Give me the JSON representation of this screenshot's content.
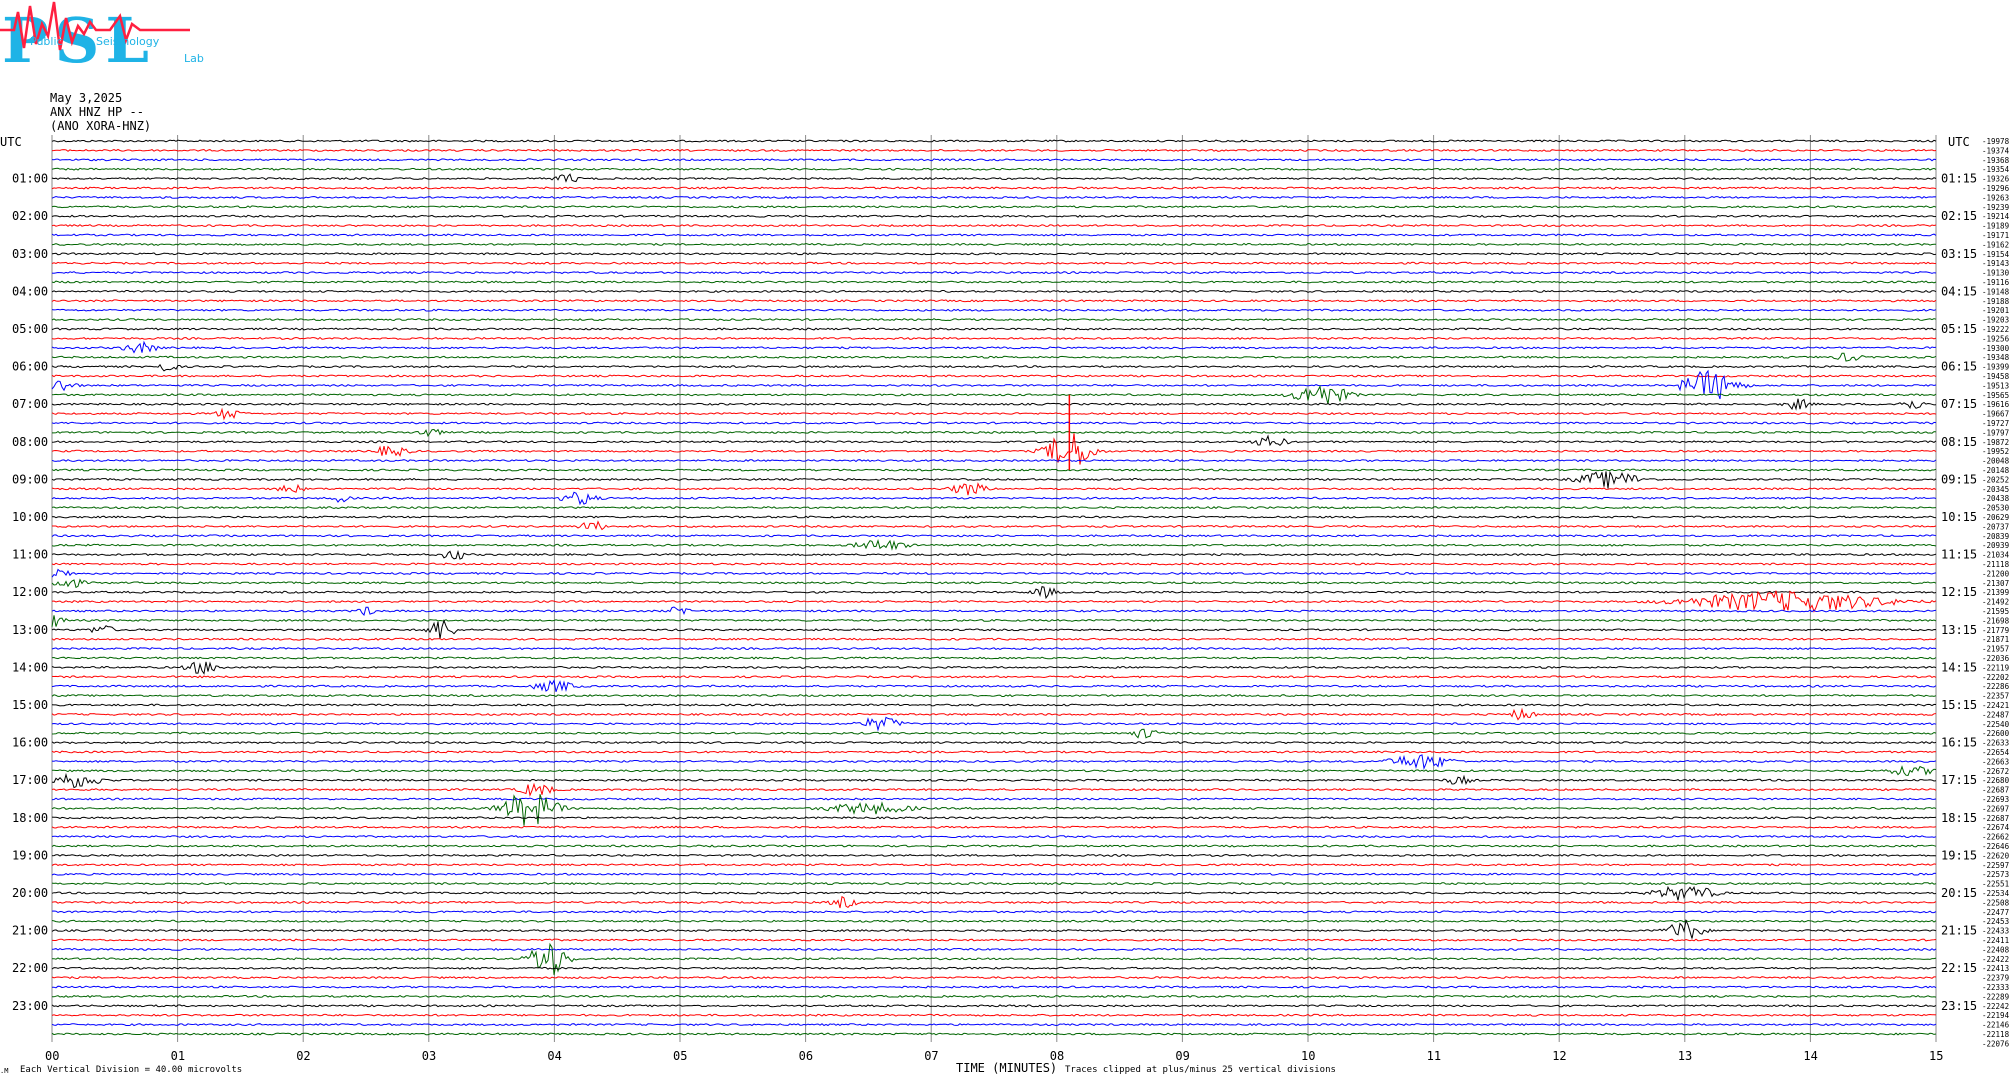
{
  "logo": {
    "letters": "PSL",
    "subtitle_a": "Public",
    "subtitle_b": "Seismology",
    "subtitle_c": "Lab"
  },
  "header": {
    "date": "May 3,2025",
    "channel": "ANX HNZ HP --",
    "source": "(ANO XORA-HNZ)"
  },
  "axis": {
    "left_label": "UTC",
    "right_label": "UTC",
    "xlabel": "TIME (MINUTES)"
  },
  "footer": {
    "scale_note": "Each Vertical Division = 40.00 microvolts",
    "clip_note": "Traces clipped at plus/minus 25 vertical divisions",
    "small_mark": ".M"
  },
  "chart_data": {
    "type": "line",
    "title": "May 3,2025",
    "xlabel": "TIME (MINUTES)",
    "xlim": [
      0,
      15
    ],
    "x_ticks": [
      "00",
      "01",
      "02",
      "03",
      "04",
      "05",
      "06",
      "07",
      "08",
      "09",
      "10",
      "11",
      "12",
      "13",
      "14",
      "15"
    ],
    "left_hour_labels": [
      "01:00",
      "02:00",
      "03:00",
      "04:00",
      "05:00",
      "06:00",
      "07:00",
      "08:00",
      "09:00",
      "10:00",
      "11:00",
      "12:00",
      "13:00",
      "14:00",
      "15:00",
      "16:00",
      "17:00",
      "18:00",
      "19:00",
      "20:00",
      "21:00",
      "22:00",
      "23:00"
    ],
    "right_hour_labels": [
      "01:15",
      "02:15",
      "03:15",
      "04:15",
      "05:15",
      "06:15",
      "07:15",
      "08:15",
      "09:15",
      "10:15",
      "11:15",
      "12:15",
      "13:15",
      "14:15",
      "15:15",
      "16:15",
      "17:15",
      "18:15",
      "19:15",
      "20:15",
      "21:15",
      "22:15",
      "23:15"
    ],
    "trace_colors": [
      "#000000",
      "#ff0000",
      "#0000ff",
      "#006400"
    ],
    "trace_count": 96,
    "minutes_per_trace": 15,
    "offsets": [
      "-19978",
      "-19374",
      "-19368",
      "-19354",
      "-19326",
      "-19296",
      "-19263",
      "-19239",
      "-19214",
      "-19189",
      "-19171",
      "-19162",
      "-19154",
      "-19143",
      "-19130",
      "-19116",
      "-19148",
      "-19188",
      "-19201",
      "-19203",
      "-19222",
      "-19256",
      "-19300",
      "-19348",
      "-19399",
      "-19458",
      "-19513",
      "-19565",
      "-19616",
      "-19667",
      "-19727",
      "-19797",
      "-19872",
      "-19952",
      "-20048",
      "-20148",
      "-20252",
      "-20345",
      "-20438",
      "-20530",
      "-20629",
      "-20737",
      "-20839",
      "-20939",
      "-21034",
      "-21118",
      "-21200",
      "-21307",
      "-21399",
      "-21492",
      "-21595",
      "-21698",
      "-21779",
      "-21871",
      "-21957",
      "-22036",
      "-22119",
      "-22202",
      "-22286",
      "-22357",
      "-22421",
      "-22487",
      "-22540",
      "-22600",
      "-22633",
      "-22654",
      "-22663",
      "-22672",
      "-22680",
      "-22687",
      "-22693",
      "-22697",
      "-22687",
      "-22674",
      "-22662",
      "-22646",
      "-22620",
      "-22597",
      "-22573",
      "-22551",
      "-22534",
      "-22508",
      "-22477",
      "-22453",
      "-22433",
      "-22411",
      "-22408",
      "-22422",
      "-22413",
      "-22379",
      "-22333",
      "-22289",
      "-22242",
      "-22194",
      "-22146",
      "-22118",
      "-22076"
    ],
    "events": [
      {
        "trace": 4,
        "minute": 4.1,
        "amp": 5,
        "dur": 0.15
      },
      {
        "trace": 22,
        "minute": 0.7,
        "amp": 6,
        "dur": 0.2
      },
      {
        "trace": 23,
        "minute": 14.3,
        "amp": 5,
        "dur": 0.15
      },
      {
        "trace": 24,
        "minute": 0.9,
        "amp": 5,
        "dur": 0.15
      },
      {
        "trace": 26,
        "minute": 0.05,
        "amp": 7,
        "dur": 0.2
      },
      {
        "trace": 26,
        "minute": 13.2,
        "amp": 16,
        "dur": 0.3
      },
      {
        "trace": 27,
        "minute": 10.1,
        "amp": 12,
        "dur": 0.3
      },
      {
        "trace": 28,
        "minute": 13.9,
        "amp": 6,
        "dur": 0.15
      },
      {
        "trace": 28,
        "minute": 14.8,
        "amp": 6,
        "dur": 0.15
      },
      {
        "trace": 29,
        "minute": 1.4,
        "amp": 6,
        "dur": 0.15
      },
      {
        "trace": 31,
        "minute": 3.0,
        "amp": 5,
        "dur": 0.15
      },
      {
        "trace": 32,
        "minute": 9.7,
        "amp": 6,
        "dur": 0.2
      },
      {
        "trace": 33,
        "minute": 8.1,
        "amp": 20,
        "dur": 0.25
      },
      {
        "trace": 33,
        "minute": 2.7,
        "amp": 6,
        "dur": 0.2
      },
      {
        "trace": 36,
        "minute": 12.4,
        "amp": 9,
        "dur": 0.35
      },
      {
        "trace": 37,
        "minute": 1.9,
        "amp": 5,
        "dur": 0.15
      },
      {
        "trace": 37,
        "minute": 7.3,
        "amp": 7,
        "dur": 0.2
      },
      {
        "trace": 38,
        "minute": 4.2,
        "amp": 7,
        "dur": 0.2
      },
      {
        "trace": 38,
        "minute": 2.3,
        "amp": 5,
        "dur": 0.1
      },
      {
        "trace": 41,
        "minute": 4.3,
        "amp": 6,
        "dur": 0.15
      },
      {
        "trace": 43,
        "minute": 6.6,
        "amp": 6,
        "dur": 0.3
      },
      {
        "trace": 44,
        "minute": 3.2,
        "amp": 6,
        "dur": 0.15
      },
      {
        "trace": 46,
        "minute": 0.05,
        "amp": 6,
        "dur": 0.15
      },
      {
        "trace": 47,
        "minute": 0.1,
        "amp": 7,
        "dur": 0.2
      },
      {
        "trace": 48,
        "minute": 7.9,
        "amp": 6,
        "dur": 0.15
      },
      {
        "trace": 49,
        "minute": 13.8,
        "amp": 11,
        "dur": 1.1
      },
      {
        "trace": 50,
        "minute": 2.5,
        "amp": 5,
        "dur": 0.1
      },
      {
        "trace": 50,
        "minute": 5.0,
        "amp": 5,
        "dur": 0.15
      },
      {
        "trace": 51,
        "minute": 0.0,
        "amp": 7,
        "dur": 0.15
      },
      {
        "trace": 52,
        "minute": 0.4,
        "amp": 5,
        "dur": 0.15
      },
      {
        "trace": 52,
        "minute": 3.1,
        "amp": 12,
        "dur": 0.15
      },
      {
        "trace": 56,
        "minute": 1.2,
        "amp": 7,
        "dur": 0.2
      },
      {
        "trace": 58,
        "minute": 4.0,
        "amp": 6,
        "dur": 0.25
      },
      {
        "trace": 61,
        "minute": 11.7,
        "amp": 6,
        "dur": 0.15
      },
      {
        "trace": 62,
        "minute": 6.6,
        "amp": 7,
        "dur": 0.25
      },
      {
        "trace": 63,
        "minute": 8.7,
        "amp": 6,
        "dur": 0.15
      },
      {
        "trace": 66,
        "minute": 10.9,
        "amp": 8,
        "dur": 0.35
      },
      {
        "trace": 67,
        "minute": 14.8,
        "amp": 5,
        "dur": 0.3
      },
      {
        "trace": 68,
        "minute": 0.15,
        "amp": 8,
        "dur": 0.35
      },
      {
        "trace": 68,
        "minute": 11.2,
        "amp": 5,
        "dur": 0.15
      },
      {
        "trace": 69,
        "minute": 3.85,
        "amp": 7,
        "dur": 0.2
      },
      {
        "trace": 71,
        "minute": 3.8,
        "amp": 18,
        "dur": 0.3
      },
      {
        "trace": 71,
        "minute": 6.5,
        "amp": 6,
        "dur": 0.5
      },
      {
        "trace": 80,
        "minute": 13.0,
        "amp": 8,
        "dur": 0.35
      },
      {
        "trace": 81,
        "minute": 6.3,
        "amp": 6,
        "dur": 0.15
      },
      {
        "trace": 84,
        "minute": 13.0,
        "amp": 11,
        "dur": 0.2
      },
      {
        "trace": 87,
        "minute": 3.95,
        "amp": 20,
        "dur": 0.2
      }
    ]
  }
}
